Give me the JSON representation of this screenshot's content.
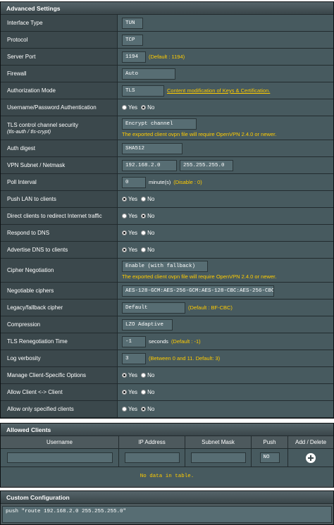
{
  "advanced": {
    "title": "Advanced Settings",
    "interface_type": {
      "label": "Interface Type",
      "value": "TUN"
    },
    "protocol": {
      "label": "Protocol",
      "value": "TCP"
    },
    "server_port": {
      "label": "Server Port",
      "value": "1194",
      "hint": "(Default : 1194)"
    },
    "firewall": {
      "label": "Firewall",
      "value": "Auto"
    },
    "auth_mode": {
      "label": "Authorization Mode",
      "value": "TLS",
      "link": "Content modification of Keys & Certification."
    },
    "userpass": {
      "label": "Username/Password Authentication",
      "yes": "Yes",
      "no": "No",
      "selected": "no"
    },
    "tls_control": {
      "label": "TLS control channel security",
      "sublabel": "(tls-auth / tls-crypt)",
      "value": "Encrypt channel",
      "hint": "The exported client ovpn file will require OpenVPN 2.4.0 or newer."
    },
    "auth_digest": {
      "label": "Auth digest",
      "value": "SHA512"
    },
    "vpn_subnet": {
      "label": "VPN Subnet / Netmask",
      "subnet": "192.168.2.0",
      "netmask": "255.255.255.0"
    },
    "poll_interval": {
      "label": "Poll Interval",
      "value": "0",
      "hint": "minute(s)",
      "hint2": "(Disable : 0)"
    },
    "push_lan": {
      "label": "Push LAN to clients",
      "yes": "Yes",
      "no": "No",
      "selected": "yes"
    },
    "direct_clients": {
      "label": "Direct clients to redirect Internet traffic",
      "yes": "Yes",
      "no": "No",
      "selected": "no"
    },
    "respond_dns": {
      "label": "Respond to DNS",
      "yes": "Yes",
      "no": "No",
      "selected": "yes"
    },
    "advertise_dns": {
      "label": "Advertise DNS to clients",
      "yes": "Yes",
      "no": "No",
      "selected": "yes"
    },
    "cipher_negotiation": {
      "label": "Cipher Negotiation",
      "value": "Enable (with fallback)",
      "hint": "The exported client ovpn file will require OpenVPN 2.4.0 or newer."
    },
    "negotiable_ciphers": {
      "label": "Negotiable ciphers",
      "value": "AES-128-GCM:AES-256-GCM:AES-128-CBC:AES-256-CBC"
    },
    "legacy_cipher": {
      "label": "Legacy/fallback cipher",
      "value": "Default",
      "hint": "(Default : BF-CBC)"
    },
    "compression": {
      "label": "Compression",
      "value": "LZO Adaptive"
    },
    "tls_reneg": {
      "label": "TLS Renegotiation Time",
      "value": "-1",
      "hint": "seconds",
      "hint2": "(Default : -1)"
    },
    "log_verbosity": {
      "label": "Log verbosity",
      "value": "3",
      "hint": "(Between 0 and 11. Default: 3)"
    },
    "manage_client": {
      "label": "Manage Client-Specific Options",
      "yes": "Yes",
      "no": "No",
      "selected": "yes"
    },
    "client_to_client": {
      "label": "Allow Client <-> Client",
      "yes": "Yes",
      "no": "No",
      "selected": "yes"
    },
    "only_specified": {
      "label": "Allow only specified clients",
      "yes": "Yes",
      "no": "No",
      "selected": "no"
    }
  },
  "allowed_clients": {
    "title": "Allowed Clients",
    "columns": [
      "Username",
      "IP Address",
      "Subnet Mask",
      "Push",
      "Add / Delete"
    ],
    "push_value": "NO",
    "empty_text": "No data in table."
  },
  "custom": {
    "title": "Custom Configuration",
    "text": "push \"route 192.168.2.0 255.255.255.0\""
  }
}
